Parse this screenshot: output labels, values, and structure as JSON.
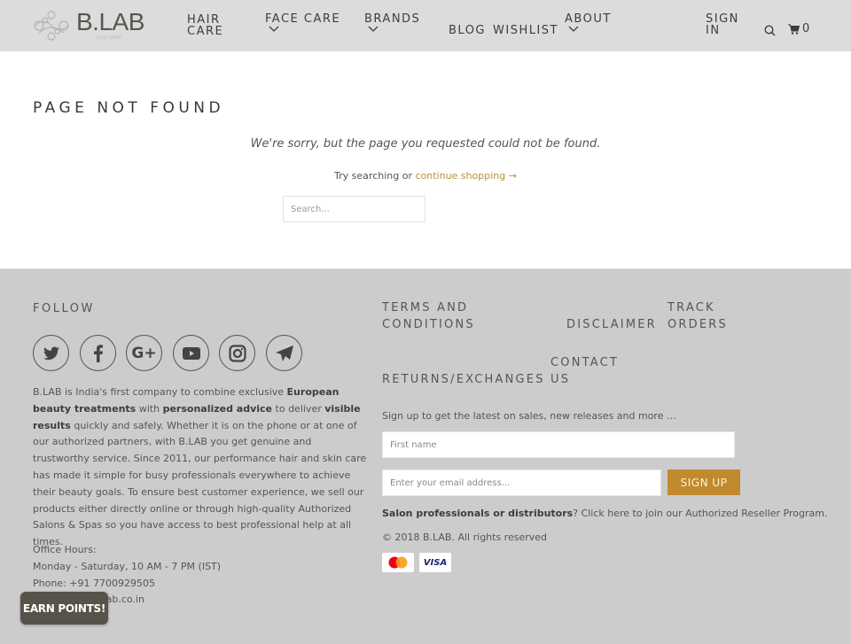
{
  "header": {
    "logo_text": "B.LAB",
    "logo_tagline": "your side!",
    "nav": [
      {
        "label": "HAIR CARE",
        "line1": "HAIR",
        "line2": "CARE"
      },
      {
        "label": "FACE CARE"
      },
      {
        "label": "BRANDS"
      },
      {
        "label": "BLOG"
      },
      {
        "label": "WISHLIST"
      },
      {
        "label": "ABOUT"
      },
      {
        "label": "SIGN IN",
        "line1": "SIGN",
        "line2": "IN"
      }
    ],
    "cart_count": "0"
  },
  "main": {
    "title": "PAGE NOT FOUND",
    "message": "We're sorry, but the page you requested could not be found.",
    "try_text": "Try searching or ",
    "continue_link": "continue shopping →",
    "search_placeholder": "Search..."
  },
  "footer": {
    "follow_heading": "FOLLOW",
    "social": [
      "twitter",
      "facebook",
      "google-plus",
      "youtube",
      "instagram",
      "telegram"
    ],
    "about": {
      "p1": "B.LAB is India's first company to combine exclusive ",
      "b1": "European beauty treatments",
      "p2": " with ",
      "b2": "personalized advice",
      "p3": " to deliver ",
      "b3": "visible results",
      "p4": " quickly and safely. Whether it is on the phone or at one of our authorized partners, with B.LAB you get genuine and trustworthy service. Since 2011, our performance hair and skin care has made it simple for busy professionals everywhere to achieve their beauty goals. To ensure best customer experience, we sell our products either directly online or through high-quality Authorized Salons & Spas so you have access to best professional help at all times."
    },
    "office": {
      "label": "Office Hours:",
      "hours": "Monday - Saturday, 10 AM - 7 PM (IST)",
      "phone": "Phone: +91 7700929505",
      "email": "Email: care@blab.co.in"
    },
    "links": {
      "terms": [
        "TERMS AND",
        "CONDITIONS"
      ],
      "disclaimer": "DISCLAIMER",
      "track": [
        "TRACK",
        "ORDERS"
      ],
      "returns": "RETURNS/EXCHANGES",
      "contact": [
        "CONTACT",
        "US"
      ]
    },
    "newsletter": {
      "text": "Sign up to get the latest on sales, new releases and more …",
      "first_name_placeholder": "First name",
      "email_placeholder": "Enter your email address...",
      "button": "SIGN UP"
    },
    "salon_bold": "Salon professionals or distributors",
    "salon_rest": "? Click here to join our Authorized Reseller Program.",
    "copyright": "© 2018 B.LAB. All rights reserved",
    "cards": [
      "mastercard",
      "VISA"
    ]
  },
  "earn_points": "EARN POINTS!",
  "colors": {
    "accent": "#c08a2e",
    "link": "#b8903a",
    "header_bg": "#dcdcdc",
    "footer_bg": "#cccccc"
  }
}
